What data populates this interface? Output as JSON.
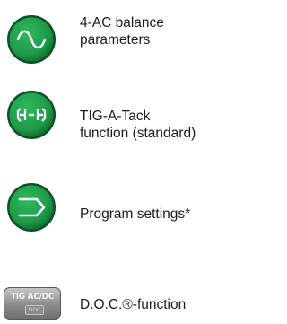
{
  "colors": {
    "button_green": "#1f9a4a",
    "button_green_dark": "#0e6a2c",
    "button_rim": "#0b5224",
    "doc_button_gray": "#8b8b8b"
  },
  "features": [
    {
      "icon": "sine-wave-icon",
      "label_lines": [
        "4-AC balance",
        "parameters"
      ]
    },
    {
      "icon": "tig-a-tack-icon",
      "label_lines": [
        "TIG-A-Tack",
        "function (standard)"
      ]
    },
    {
      "icon": "program-arrow-icon",
      "label_lines": [
        "Program settings*"
      ]
    },
    {
      "icon": "doc-button-icon",
      "button_text": "TIG AC/DC",
      "button_subtext": "DOC",
      "label_lines": [
        "D.O.C.®-function"
      ]
    }
  ]
}
